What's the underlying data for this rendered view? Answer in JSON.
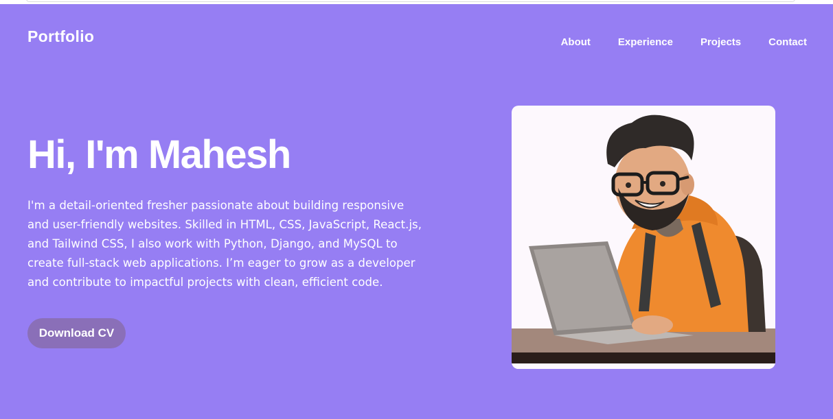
{
  "header": {
    "logo": "Portfolio",
    "nav": [
      "About",
      "Experience",
      "Projects",
      "Contact"
    ]
  },
  "hero": {
    "title": "Hi, I'm Mahesh",
    "description": "I'm a detail-oriented fresher passionate about building responsive and user-friendly websites. Skilled in HTML, CSS, JavaScript, React.js, and Tailwind CSS, I also work with Python, Django, and MySQL to create full-stack web applications. I’m eager to grow as a developer and contribute to impactful projects with clean, efficient code.",
    "cta_label": "Download CV"
  },
  "colors": {
    "background": "#967ef3",
    "button": "#8a6fb8",
    "text": "#ffffff"
  },
  "icons": {
    "portrait": "developer-avatar-illustration"
  }
}
